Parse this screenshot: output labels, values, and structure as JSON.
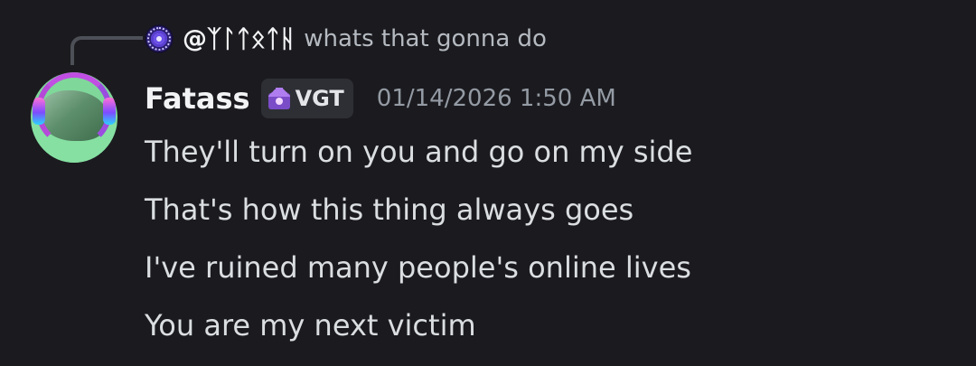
{
  "reply": {
    "avatar_icon": "reply-avatar-icon",
    "name": "@ᛉᛚᛏᛟᛏᚺ",
    "text": "whats that gonna do"
  },
  "message": {
    "author": "Fatass",
    "tag": {
      "icon": "crown-badge-icon",
      "label": "VGT",
      "color": "#7b4cc8"
    },
    "timestamp": "01/14/2026 1:50 AM",
    "lines": [
      "They'll turn on you and go on my side",
      "That's how this thing always goes",
      "I've ruined many people's online lives",
      "You are my next victim"
    ]
  },
  "colors": {
    "background": "#1b1b1f",
    "username": "#f2f3f5",
    "message_text": "#dbdee1",
    "muted_text": "#949ba4"
  }
}
